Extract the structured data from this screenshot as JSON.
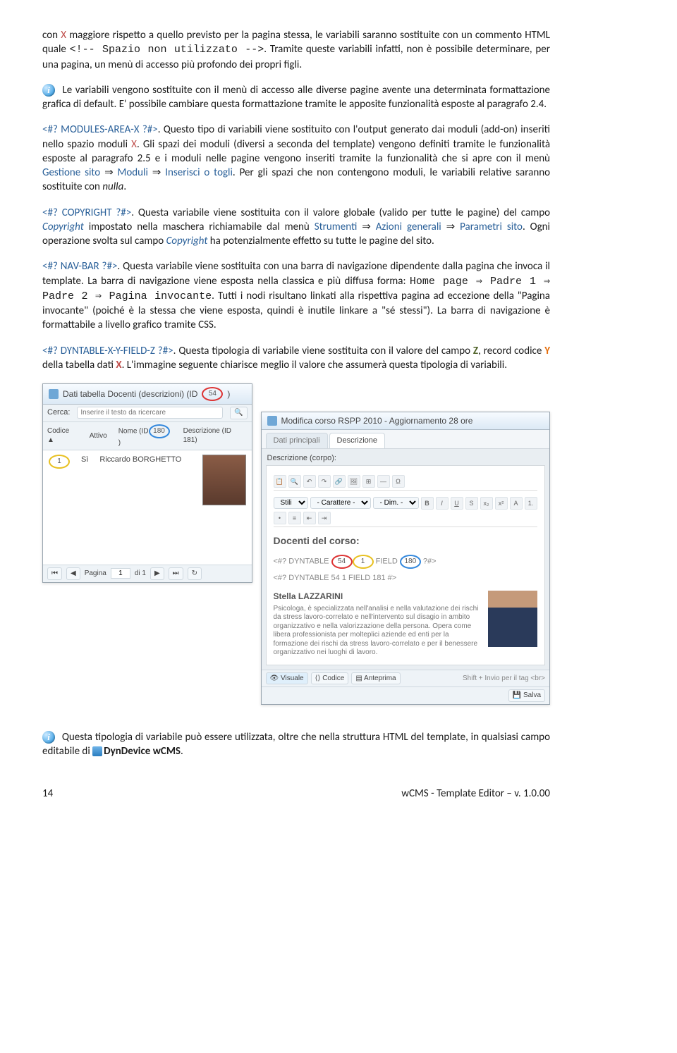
{
  "para1_a": "con ",
  "para1_x": "X",
  "para1_b": " maggiore rispetto a quello previsto per la pagina stessa, le variabili saranno sostituite con un commento HTML quale ",
  "para1_code": "<!-- Spazio non utilizzato -->",
  "para1_c": ". Tramite queste variabili infatti, non è possibile determinare, per una pagina, un menù di accesso più profondo dei propri figli.",
  "para2": "Le variabili vengono sostituite con il menù di accesso alle diverse pagine avente una determinata formattazione grafica di default. E' possibile cambiare questa formattazione tramite le apposite funzionalità esposte al paragrafo 2.4.",
  "para3_tag": "<#? MODULES-AREA-X ?#>",
  "para3_a": ". Questo tipo di variabili viene sostituito con l'output generato dai moduli (add-on) inseriti nello spazio moduli ",
  "para3_x": "X",
  "para3_b": ". Gli spazi dei moduli (diversi a seconda del template) vengono definiti tramite le funzionalità esposte al paragrafo 2.5 e i moduli nelle pagine vengono inseriti tramite la funzionalità che si apre con il menù ",
  "para3_menu1": "Gestione sito ",
  "para3_arrow": "⇒",
  "para3_menu2": " Moduli ",
  "para3_menu3": " Inserisci o togli",
  "para3_c": ". Per gli spazi che non contengono moduli, le variabili relative saranno sostituite con ",
  "para3_nulla": "nulla",
  "para3_d": ".",
  "para4_tag": "<#? COPYRIGHT ?#>",
  "para4_a": ". Questa variabile viene sostituita con il valore globale (valido per tutte le pagine) del campo ",
  "para4_copyright": "Copyright",
  "para4_b": " impostato nella maschera richiamabile dal menù ",
  "para4_m1": "Strumenti ",
  "para4_m2": " Azioni generali ",
  "para4_m3": " Parametri sito",
  "para4_c": ". Ogni operazione svolta sul campo ",
  "para4_d": " ha potenzialmente effetto su tutte le pagine del sito.",
  "para5_tag": "<#? NAV-BAR ?#>",
  "para5_a": ". Questa variabile viene sostituita con una barra di navigazione dipendente dalla pagina che invoca il template. La barra di navigazione viene esposta nella classica e più diffusa forma: ",
  "para5_code": "Home page ⇒ Padre 1 ⇒ Padre 2 ⇒ Pagina invocante",
  "para5_b": ". Tutti i nodi risultano linkati alla rispettiva pagina ad eccezione della \"Pagina invocante\" (poiché è la stessa che viene esposta, quindi è inutile linkare a \"sé stessi\"). La barra di navigazione è formattabile a livello grafico tramite CSS.",
  "para6_tag": "<#? DYNTABLE-X-Y-FIELD-Z ?#>",
  "para6_a": ". Questa tipologia di variabile viene sostituita con il valore del campo ",
  "para6_z": "Z",
  "para6_b": ", record codice ",
  "para6_y": "Y",
  "para6_c": " della tabella dati ",
  "para6_x": "X",
  "para6_d": ". L'immagine seguente chiarisce meglio il valore che assumerà questa tipologia di variabili.",
  "para7_a": "Questa tipologia di variabile può essere utilizzata, oltre che nella struttura HTML del template, in qualsiasi campo editabile di ",
  "para7_app": "DynDevice wCMS",
  "para7_b": ".",
  "shot1": {
    "title": "Dati tabella Docenti (descrizioni) (ID",
    "title_id": "54",
    "title_close": ")",
    "search_label": "Cerca:",
    "search_ph": "Inserire il testo da ricercare",
    "col_codice": "Codice",
    "col_attivo": "Attivo",
    "col_nome": "Nome (ID",
    "col_nome_id": "180",
    "col_nome_close": ")",
    "col_descr": "Descrizione (ID 181)",
    "row_code": "1",
    "row_attivo": "Sì",
    "row_nome": "Riccardo BORGHETTO",
    "paging": "Pagina",
    "paging_val": "1",
    "paging_of": "di 1"
  },
  "shot2": {
    "title": "Modifica corso RSPP 2010 - Aggiornamento 28 ore",
    "tab1": "Dati principali",
    "tab2": "Descrizione",
    "desc_label": "Descrizione (corpo):",
    "sel1": "Stili",
    "sel2": "- Carattere -",
    "sel3": "- Dim. -",
    "heading": "Docenti del corso:",
    "tagline1_a": "<#? DYNTABLE ",
    "tagline1_54": "54",
    "tagline1_1": "1",
    "tagline1_f": " FIELD ",
    "tagline1_180": "180",
    "tagline1_b": " ?#>",
    "tagline2": "<#? DYNTABLE 54 1 FIELD 181 #>",
    "name2": "Stella LAZZARINI",
    "bio": "Psicologa, è specializzata nell'analisi e nella valutazione dei rischi da stress lavoro-correlato e nell'intervento sul disagio in ambito organizzativo e nella valorizzazione della persona. Opera come libera professionista per molteplici aziende ed enti per la formazione dei rischi da stress lavoro-correlato e per il benessere organizzativo nei luoghi di lavoro.",
    "view1": "Visuale",
    "view2": "Codice",
    "view3": "Anteprima",
    "hint": "Shift + Invio per il tag <br>",
    "save": "Salva"
  },
  "footer_left": "14",
  "footer_right": "wCMS - Template Editor – v. 1.0.00"
}
